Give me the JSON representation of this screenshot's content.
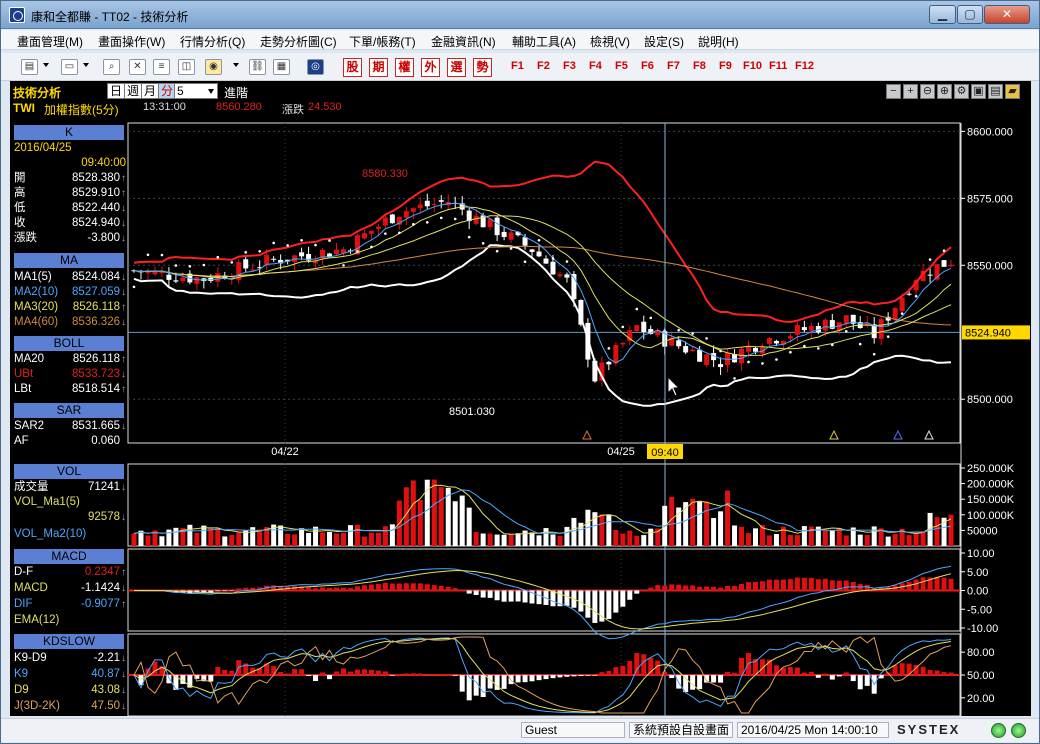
{
  "window": {
    "title": "康和全都賺 - TT02 - 技術分析"
  },
  "menu": [
    "畫面管理(M)",
    "畫面操作(W)",
    "行情分析(Q)",
    "走勢分析圖(C)",
    "下單/帳務(T)",
    "金融資訊(N)",
    "輔助工具(A)",
    "檢視(V)",
    "設定(S)",
    "說明(H)"
  ],
  "toolbar": {
    "red_keys": [
      "股",
      "期",
      "權",
      "外",
      "選",
      "勢"
    ],
    "fkeys": [
      "F1",
      "F2",
      "F3",
      "F4",
      "F5",
      "F6",
      "F7",
      "F8",
      "F9",
      "F10",
      "F11",
      "F12"
    ]
  },
  "header": {
    "title": "技術分析",
    "seg_day": "日",
    "seg_week": "週",
    "seg_month": "月",
    "seg_minute": "分",
    "period": "5",
    "advanced": "進階",
    "symbol": "TWI",
    "symbol_name": "加權指數(5分)",
    "time": "13:31:00",
    "price": "8560.280",
    "change_label": "漲跌",
    "change": "24.530"
  },
  "panel": {
    "k_title": "K",
    "date": "2016/04/25",
    "time": "09:40:00",
    "open_label": "開",
    "open": "8528.380",
    "high_label": "高",
    "high": "8529.910",
    "low_label": "低",
    "low": "8522.440",
    "close_label": "收",
    "close": "8524.940",
    "chg_label": "漲跌",
    "chg": "-3.800",
    "ma_title": "MA",
    "ma1_label": "MA1(5)",
    "ma1": "8524.084",
    "ma2_label": "MA2(10)",
    "ma2": "8527.059",
    "ma3_label": "MA3(20)",
    "ma3": "8526.118",
    "ma4_label": "MA4(60)",
    "ma4": "8536.326",
    "boll_title": "BOLL",
    "boll_ma_label": "MA20",
    "boll_ma": "8526.118",
    "ubt_label": "UBt",
    "ubt": "8533.723",
    "lbt_label": "LBt",
    "lbt": "8518.514",
    "sar_title": "SAR",
    "sar2_label": "SAR2",
    "sar2": "8531.665",
    "af_label": "AF",
    "af": "0.060",
    "vol_title": "VOL",
    "vol_label": "成交量",
    "vol": "71241",
    "vol_ma1_label": "VOL_Ma1(5)",
    "vol_ma1": "92578",
    "vol_ma2_label": "VOL_Ma2(10)",
    "macd_title": "MACD",
    "df_label": "D-F",
    "df": "0.2347",
    "macd_label": "MACD",
    "macd": "-1.1424",
    "dif_label": "DIF",
    "dif": "-0.9077",
    "ema_label": "EMA(12)",
    "kd_title": "KDSLOW",
    "k9d9_label": "K9-D9",
    "k9d9": "-2.21",
    "k9_label": "K9",
    "k9": "40.87",
    "d9_label": "D9",
    "d9": "43.08",
    "j_label": "J(3D-2K)",
    "j": "47.50"
  },
  "chart_data": {
    "type": "candlestick",
    "price_axis": {
      "ticks": [
        "8600.000",
        "8575.000",
        "8550.000",
        "8500.000"
      ],
      "current": "8524.940",
      "ylim": [
        8490,
        8602
      ]
    },
    "date_labels": [
      "04/22",
      "04/25"
    ],
    "cursor_time": "09:40",
    "annotations": {
      "high": "8580.330",
      "low": "8501.030"
    },
    "volume_axis": [
      "250.000K",
      "200.000K",
      "150.000K",
      "100.000K",
      "50000"
    ],
    "macd_axis": [
      "10.00",
      "5.00",
      "0.00",
      "-5.00",
      "-10.00"
    ],
    "kd_axis": [
      "80.00",
      "50.00",
      "20.00"
    ],
    "colors": {
      "up": "#e01010",
      "down": "#ffffff",
      "boll": "#ff2020",
      "lower": "#ffffff",
      "ma5": "#4da6ff",
      "ma10": "#e0e060",
      "ma60": "#d08a40",
      "sar": "#ffffff"
    }
  },
  "status": {
    "user": "Guest",
    "screen": "系統預設自設畫面",
    "datetime": "2016/04/25 Mon 14:00:10",
    "brand": "SYSTEX"
  }
}
